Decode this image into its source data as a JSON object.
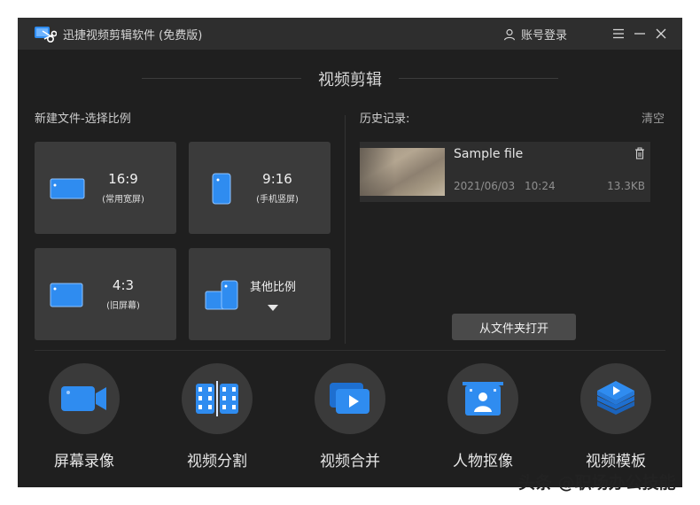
{
  "window": {
    "title": "迅捷视频剪辑软件 (免费版)",
    "account_label": "账号登录"
  },
  "main": {
    "section_title": "视频剪辑",
    "new_file_title": "新建文件-选择比例",
    "ratios": [
      {
        "ratio": "16:9",
        "desc": "(常用宽屏)"
      },
      {
        "ratio": "9:16",
        "desc": "(手机竖屏)"
      },
      {
        "ratio": "4:3",
        "desc": "(旧屏幕)"
      },
      {
        "ratio": "其他比例",
        "desc": ""
      }
    ],
    "history_title": "历史记录:",
    "clear_label": "清空",
    "history": [
      {
        "name": "Sample file",
        "date": "2021/06/03",
        "time": "10:24",
        "size": "13.3KB"
      }
    ],
    "open_folder_label": "从文件夹打开"
  },
  "tools": [
    {
      "label": "屏幕录像",
      "icon": "camera-icon"
    },
    {
      "label": "视频分割",
      "icon": "film-split-icon"
    },
    {
      "label": "视频合并",
      "icon": "video-merge-icon"
    },
    {
      "label": "人物抠像",
      "icon": "person-cutout-icon"
    },
    {
      "label": "视频模板",
      "icon": "layers-template-icon"
    }
  ],
  "watermark": "头条 @职场办公技能",
  "colors": {
    "accent": "#2f8cf0",
    "window_bg": "#1f1f1f",
    "card_bg": "#3b3b3b"
  }
}
